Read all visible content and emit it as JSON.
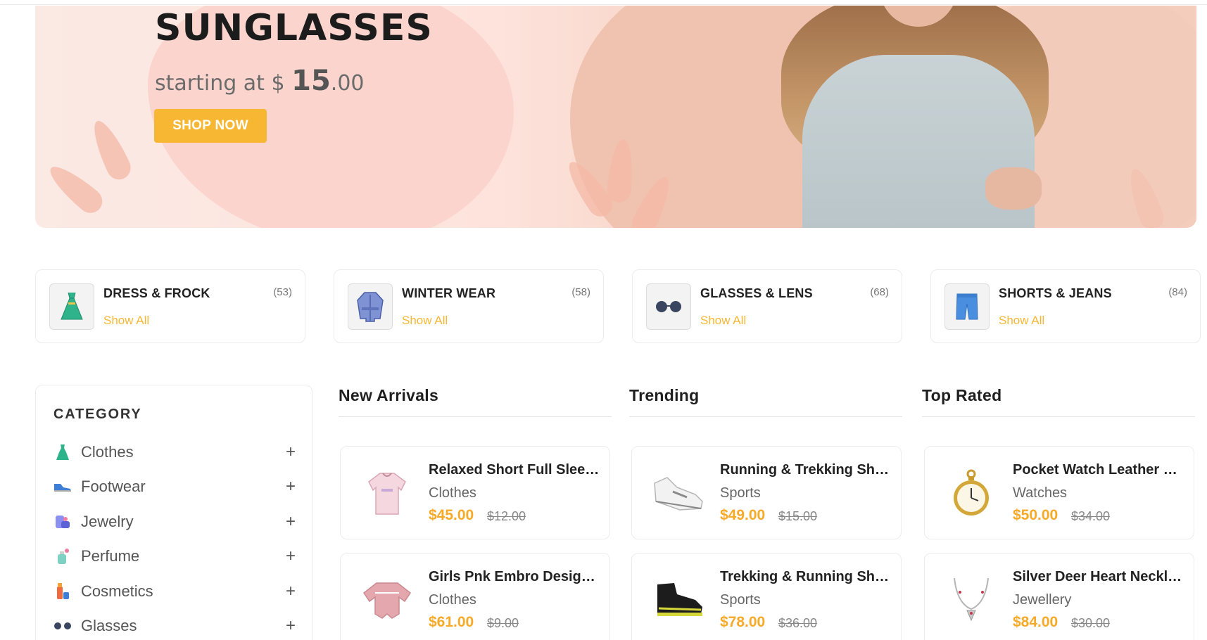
{
  "banner": {
    "title": "SUNGLASSES",
    "subtitle_prefix": "starting at $ ",
    "subtitle_big": "15",
    "subtitle_suffix": ".00",
    "button_label": "SHOP NOW"
  },
  "categories": [
    {
      "name": "DRESS & FROCK",
      "count": "(53)",
      "link": "Show All",
      "icon": "dress-icon"
    },
    {
      "name": "WINTER WEAR",
      "count": "(58)",
      "link": "Show All",
      "icon": "coat-icon"
    },
    {
      "name": "GLASSES & LENS",
      "count": "(68)",
      "link": "Show All",
      "icon": "glasses-icon"
    },
    {
      "name": "SHORTS & JEANS",
      "count": "(84)",
      "link": "Show All",
      "icon": "shorts-icon"
    }
  ],
  "sidebar": {
    "title": "CATEGORY",
    "items": [
      {
        "label": "Clothes",
        "icon": "dress-icon"
      },
      {
        "label": "Footwear",
        "icon": "shoe-icon"
      },
      {
        "label": "Jewelry",
        "icon": "jewelry-icon"
      },
      {
        "label": "Perfume",
        "icon": "perfume-icon"
      },
      {
        "label": "Cosmetics",
        "icon": "cosmetics-icon"
      },
      {
        "label": "Glasses",
        "icon": "glasses-icon"
      }
    ],
    "expand_symbol": "+"
  },
  "columns": [
    {
      "title": "New Arrivals",
      "products": [
        {
          "name": "Relaxed Short Full Sleeve T-Shirt",
          "category": "Clothes",
          "price": "$45.00",
          "old_price": "$12.00",
          "icon": "shirt-icon"
        },
        {
          "name": "Girls Pnk Embro Design Top",
          "category": "Clothes",
          "price": "$61.00",
          "old_price": "$9.00",
          "icon": "top-icon"
        }
      ]
    },
    {
      "title": "Trending",
      "products": [
        {
          "name": "Running & Trekking Shoes - White",
          "category": "Sports",
          "price": "$49.00",
          "old_price": "$15.00",
          "icon": "sneaker-icon"
        },
        {
          "name": "Trekking & Running Shoes - Black",
          "category": "Sports",
          "price": "$78.00",
          "old_price": "$36.00",
          "icon": "boot-icon"
        }
      ]
    },
    {
      "title": "Top Rated",
      "products": [
        {
          "name": "Pocket Watch Leather Pouch",
          "category": "Watches",
          "price": "$50.00",
          "old_price": "$34.00",
          "icon": "pocket-watch-icon"
        },
        {
          "name": "Silver Deer Heart Necklace",
          "category": "Jewellery",
          "price": "$84.00",
          "old_price": "$30.00",
          "icon": "necklace-icon"
        }
      ]
    }
  ],
  "colors": {
    "accent": "#f7b733",
    "price": "#f7a928",
    "text": "#212121"
  }
}
